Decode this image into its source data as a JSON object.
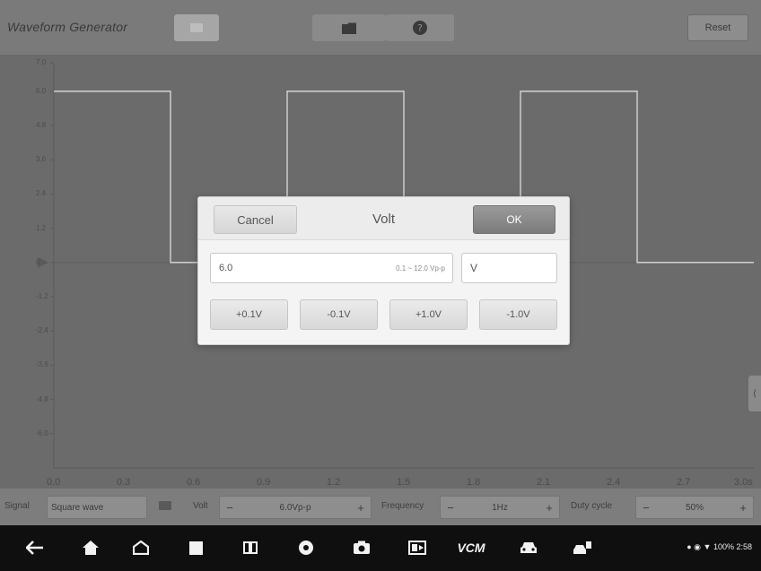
{
  "window": {
    "title": "Waveform Generator",
    "reset_label": "Reset"
  },
  "plot": {
    "y_ticks": [
      "7.0",
      "6.0",
      "4.8",
      "3.6",
      "2.4",
      "1.2",
      "0",
      "-1.2",
      "-2.4",
      "-3.6",
      "-4.8",
      "-6.0"
    ],
    "x_ticks": [
      "0.0",
      "0.3",
      "0.6",
      "0.9",
      "1.2",
      "1.5",
      "1.8",
      "2.1",
      "2.4",
      "2.7",
      "3.0s"
    ],
    "wave": {
      "type": "square",
      "high": 6.0,
      "low": 0,
      "period_s": 1.0,
      "duty_cycle": 0.5,
      "phase_start_s": 0.0
    }
  },
  "params": {
    "signal_label": "Signal",
    "signal_value": "Square wave",
    "volt_label": "Volt",
    "volt_value": "6.0Vp-p",
    "frequency_label": "Frequency",
    "frequency_value": "1Hz",
    "duty_label": "Duty cycle",
    "duty_value": "50%",
    "minus": "−",
    "plus": "+"
  },
  "dialog": {
    "cancel_label": "Cancel",
    "title": "Volt",
    "ok_label": "OK",
    "input_value": "6.0",
    "input_range": "0.1 ~ 12.0 Vp-p",
    "unit": "V",
    "steps": [
      "+0.1V",
      "-0.1V",
      "+1.0V",
      "-1.0V"
    ]
  },
  "navbar": {
    "vcm_label": "VCM",
    "status": "100% 2:58"
  },
  "colors": {
    "overlay_bg": "#6e6e6e",
    "wave_color": "#dcdcdc",
    "ok_button": "#8a8a8a",
    "navbar": "#0f0f0f"
  }
}
